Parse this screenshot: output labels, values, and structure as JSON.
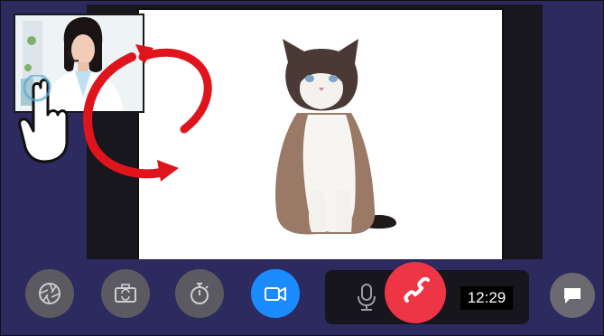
{
  "controls": [
    {
      "icon": "aperture-icon"
    },
    {
      "icon": "camera-switch-icon"
    },
    {
      "icon": "timer-icon"
    },
    {
      "icon": "video-camera-icon",
      "active_color": "#1a8cff"
    },
    {
      "icon": "microphone-icon"
    },
    {
      "icon": "end-call-icon",
      "color": "#ee3545"
    },
    {
      "icon": "chat-icon"
    }
  ],
  "call": {
    "duration": "12:29"
  },
  "colors": {
    "background": "#2c2a5e",
    "button": "#5a5a60",
    "accent_blue": "#1a8cff",
    "end_call_red": "#ee3545",
    "swap_arrows": "#e0141c"
  }
}
